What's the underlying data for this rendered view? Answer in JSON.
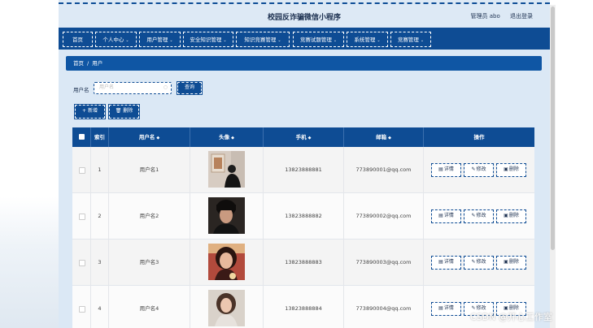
{
  "header": {
    "title": "校园反诈骗微信小程序",
    "admin_label": "管理员 abo",
    "logout_label": "退出登录"
  },
  "nav": {
    "items": [
      {
        "label": "首页",
        "has_dropdown": false
      },
      {
        "label": "个人中心",
        "has_dropdown": true
      },
      {
        "label": "用户管理",
        "has_dropdown": true
      },
      {
        "label": "安全知识管理",
        "has_dropdown": true
      },
      {
        "label": "知识竞赛管理",
        "has_dropdown": true
      },
      {
        "label": "竞赛试题管理",
        "has_dropdown": true
      },
      {
        "label": "系统管理",
        "has_dropdown": true
      },
      {
        "label": "竞赛管理",
        "has_dropdown": true
      }
    ]
  },
  "breadcrumb": {
    "home": "首页",
    "separator": "/",
    "current": "用户"
  },
  "search": {
    "label": "用户名",
    "placeholder": "用户名",
    "button": "查询"
  },
  "actions": {
    "add": "新增",
    "delete": "删除"
  },
  "table": {
    "headers": {
      "index": "索引",
      "username": "用户名",
      "avatar": "头像",
      "phone": "手机",
      "email": "邮箱",
      "ops": "操作"
    },
    "rows": [
      {
        "index": "1",
        "username": "用户名1",
        "phone": "13823888881",
        "email": "773890001@qq.com"
      },
      {
        "index": "2",
        "username": "用户名2",
        "phone": "13823888882",
        "email": "773890002@qq.com"
      },
      {
        "index": "3",
        "username": "用户名3",
        "phone": "13823888883",
        "email": "773890003@qq.com"
      },
      {
        "index": "4",
        "username": "用户名4",
        "phone": "13823888884",
        "email": "773890004@qq.com"
      }
    ],
    "row_actions": {
      "detail": "详情",
      "edit": "修改",
      "delete": "删除"
    }
  },
  "watermark": "CSDN @开心工作室",
  "colors": {
    "primary": "#0e4c94",
    "page_bg": "#dbe8f5"
  }
}
